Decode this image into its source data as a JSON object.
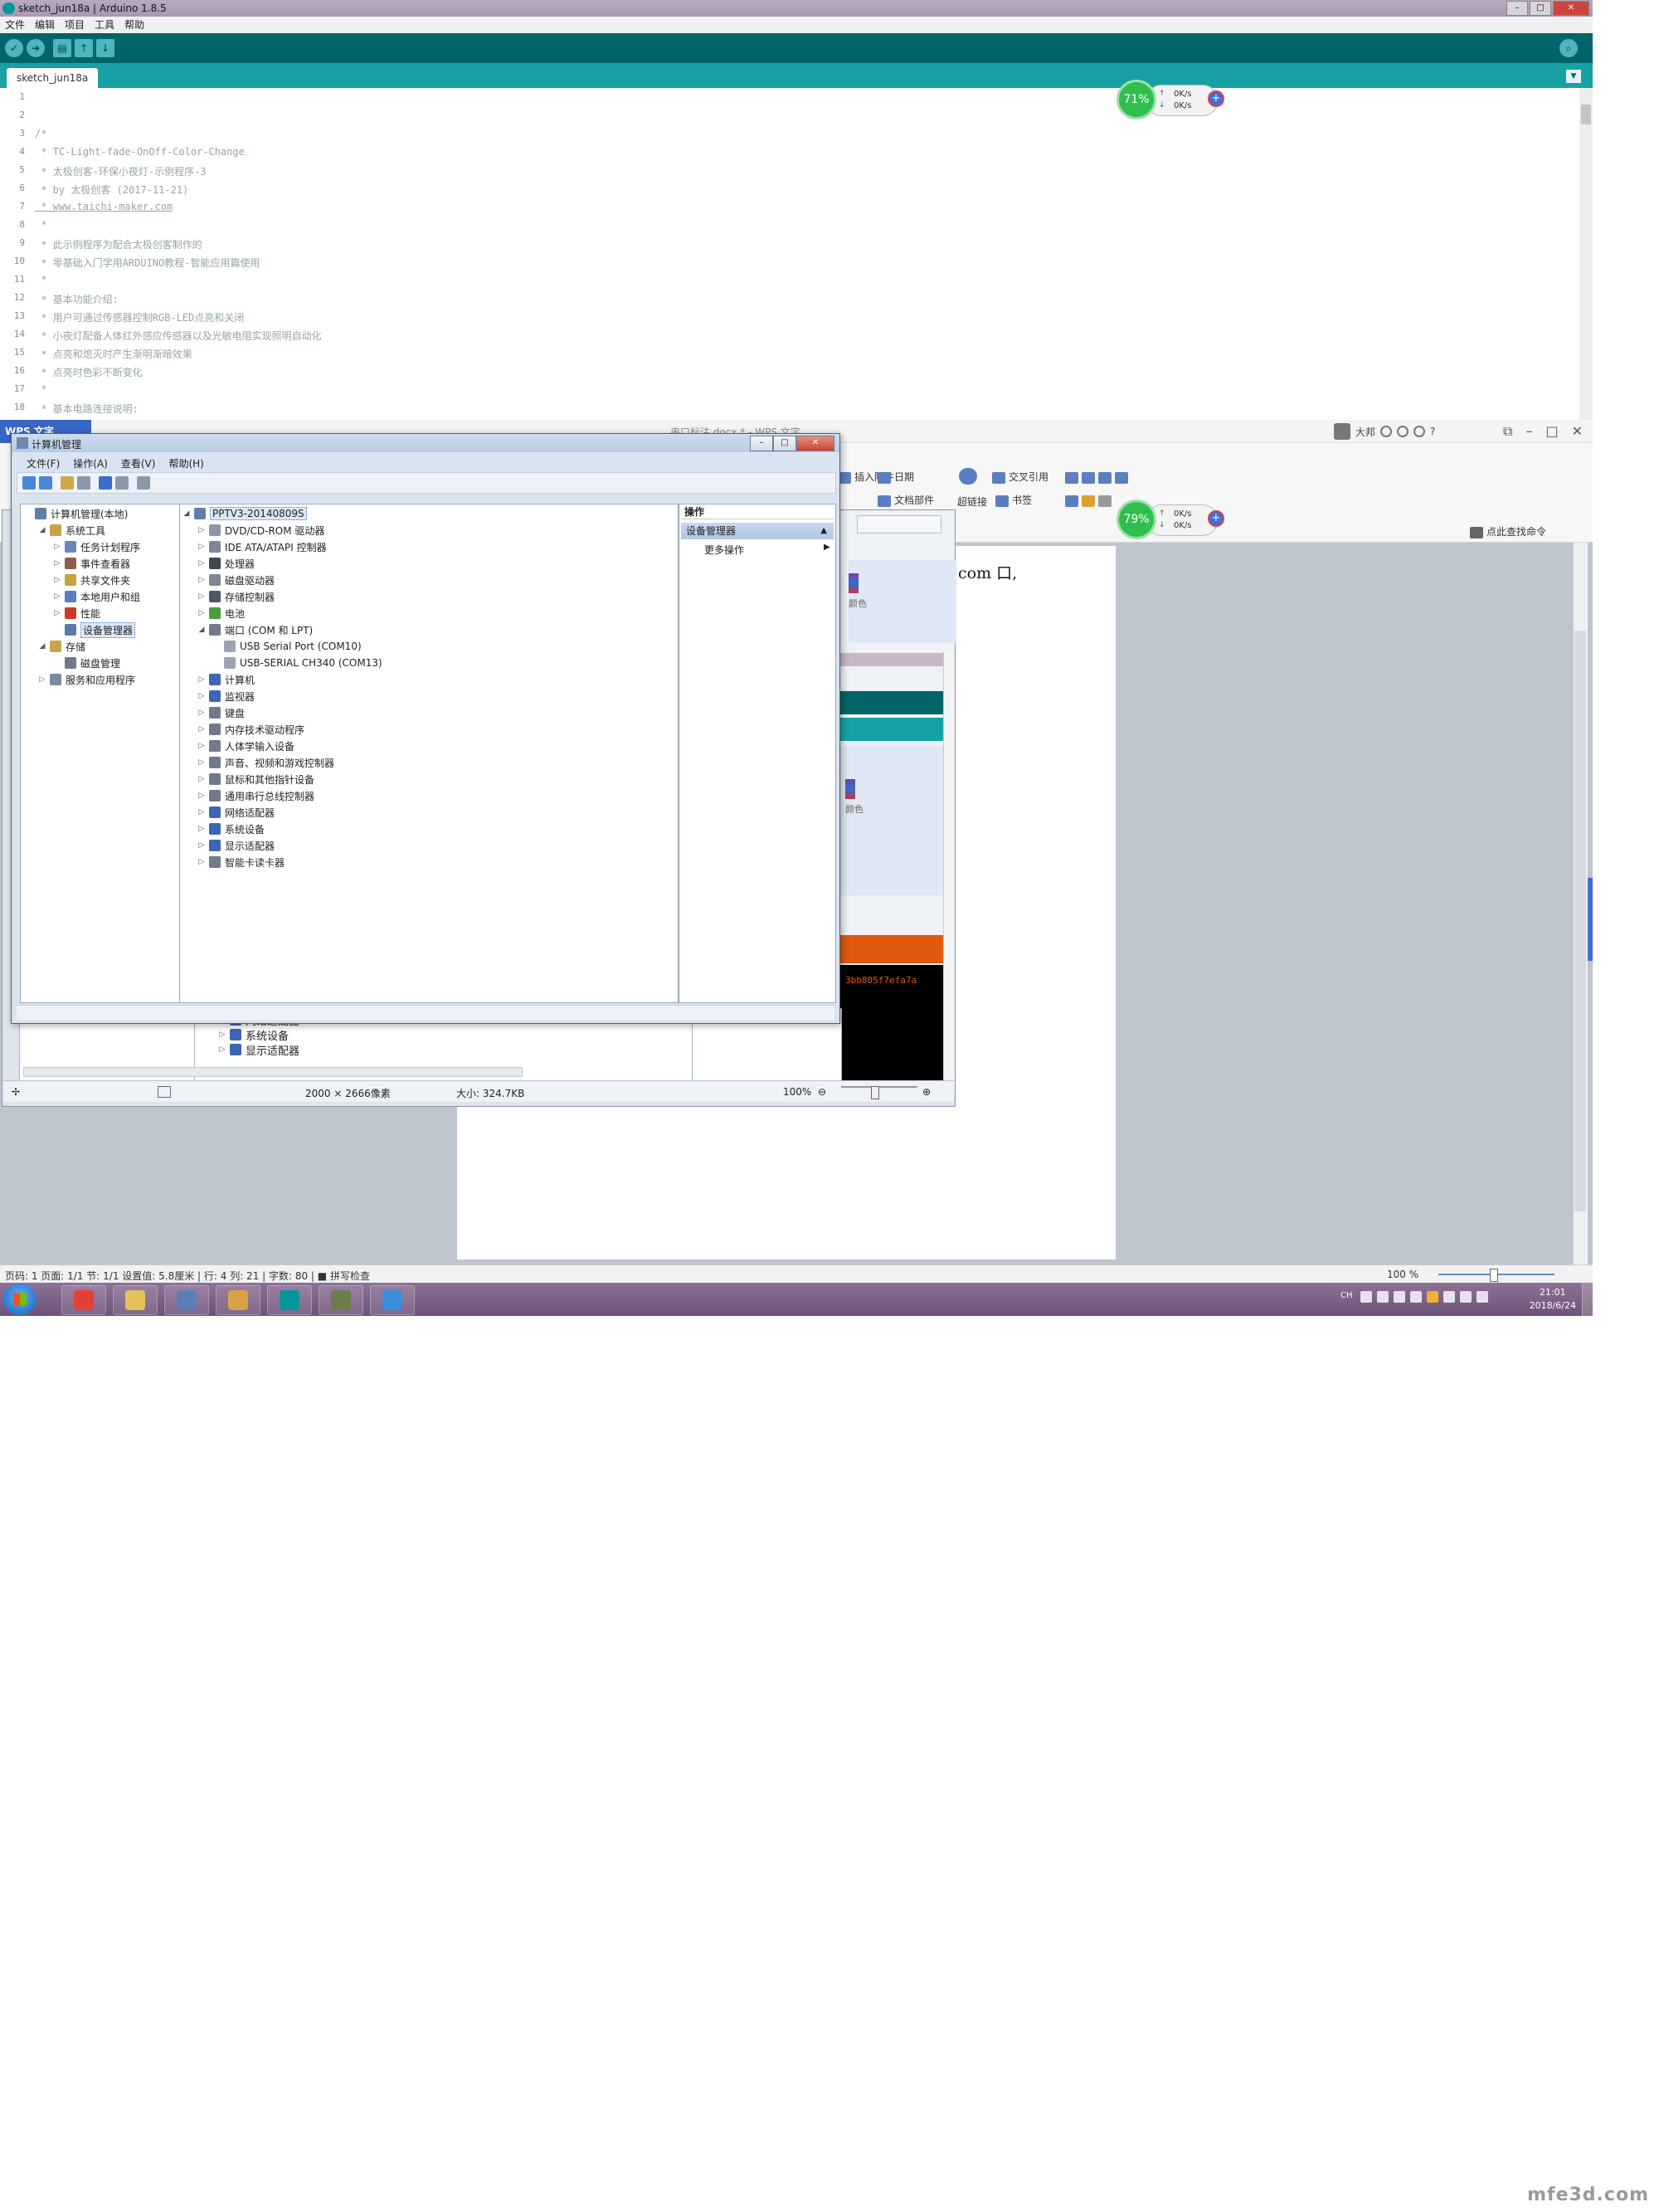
{
  "arduino": {
    "title": "sketch_jun18a | Arduino 1.8.5",
    "menu": [
      "文件",
      "编辑",
      "项目",
      "工具",
      "帮助"
    ],
    "tab": "sketch_jun18a",
    "lines": [
      {
        "n": "1",
        "text": ""
      },
      {
        "n": "2",
        "text": ""
      },
      {
        "n": "3",
        "text": "/*"
      },
      {
        "n": "4",
        "text": " * TC-Light-fade-OnOff-Color-Change"
      },
      {
        "n": "5",
        "text": " * 太极创客-环保小夜灯-示例程序-3"
      },
      {
        "n": "6",
        "text": " * by 太极创客 (2017-11-21)"
      },
      {
        "n": "7",
        "text": " * www.taichi-maker.com"
      },
      {
        "n": "8",
        "text": " *"
      },
      {
        "n": "9",
        "text": " * 此示例程序为配合太极创客制作的"
      },
      {
        "n": "10",
        "text": " * 零基础入门学用ARDUINO教程-智能应用篇使用"
      },
      {
        "n": "11",
        "text": " *"
      },
      {
        "n": "12",
        "text": " * 基本功能介绍:"
      },
      {
        "n": "13",
        "text": " * 用户可通过传感器控制RGB-LED点亮和关闭"
      },
      {
        "n": "14",
        "text": " * 小夜灯配备人体红外感应传感器以及光敏电阻实现照明自动化"
      },
      {
        "n": "15",
        "text": " * 点亮和熄灭时产生渐明渐暗效果"
      },
      {
        "n": "16",
        "text": " * 点亮时色彩不断变化"
      },
      {
        "n": "17",
        "text": " *"
      },
      {
        "n": "18",
        "text": " * 基本电路连接说明:"
      }
    ]
  },
  "speed_top": {
    "percent": "71%",
    "up": "0K/s",
    "down": "0K/s"
  },
  "speed_mid": {
    "percent": "79%",
    "up": "0K/s",
    "down": "0K/s"
  },
  "wps": {
    "tab": "WPS 文字",
    "doc_title": "串口标注.docx * - WPS 文字",
    "user": "大邦",
    "ribbon": {
      "attach": "插入附件",
      "docpart": "文档部件",
      "date": "日期",
      "xref": "交叉引用",
      "hyperlink": "超链接",
      "bookmark": "书签",
      "search": "点此查找命令"
    },
    "doc_text": "com  口,",
    "status": "页码: 1   页面: 1/1   节: 1/1   设置值: 5.8厘米 | 行: 4  列: 21 | 字数: 80 | ■ 拼写检查",
    "zoom": "100 %"
  },
  "viewer": {
    "dims": "2000 × 2666像素",
    "size": "大小: 324.7KB",
    "zoom": "100%",
    "hex_fragment": "3bb805f7efa7a",
    "color_label_1": "颜色",
    "color_label_2": "颜色",
    "tree_fragment": [
      "网络适配器",
      "系统设备",
      "显示适配器"
    ]
  },
  "cm": {
    "title": "计算机管理",
    "menu": [
      "文件(F)",
      "操作(A)",
      "查看(V)",
      "帮助(H)"
    ],
    "left_tree": [
      {
        "label": "计算机管理(本地)",
        "level": 0,
        "exp": "",
        "color": "#5f7ea8"
      },
      {
        "label": "系统工具",
        "level": 1,
        "exp": "◢",
        "color": "#caa24a"
      },
      {
        "label": "任务计划程序",
        "level": 2,
        "exp": "▷",
        "color": "#6a86b5"
      },
      {
        "label": "事件查看器",
        "level": 2,
        "exp": "▷",
        "color": "#8e5f4a"
      },
      {
        "label": "共享文件夹",
        "level": 2,
        "exp": "▷",
        "color": "#c9a241"
      },
      {
        "label": "本地用户和组",
        "level": 2,
        "exp": "▷",
        "color": "#5b7dc2"
      },
      {
        "label": "性能",
        "level": 2,
        "exp": "▷",
        "color": "#cc3a2a"
      },
      {
        "label": "设备管理器",
        "level": 2,
        "exp": "",
        "color": "#5a7aa8",
        "selected": true
      },
      {
        "label": "存储",
        "level": 1,
        "exp": "◢",
        "color": "#caa24a"
      },
      {
        "label": "磁盘管理",
        "level": 2,
        "exp": "",
        "color": "#6d7a8c"
      },
      {
        "label": "服务和应用程序",
        "level": 1,
        "exp": "▷",
        "color": "#7b8aa0"
      }
    ],
    "device_root": "PPTV3-20140809S",
    "devices": [
      {
        "label": "DVD/CD-ROM 驱动器",
        "level": 1,
        "exp": "▷",
        "color": "#8c96a6"
      },
      {
        "label": "IDE ATA/ATAPI 控制器",
        "level": 1,
        "exp": "▷",
        "color": "#7d8796"
      },
      {
        "label": "处理器",
        "level": 1,
        "exp": "▷",
        "color": "#3f4854"
      },
      {
        "label": "磁盘驱动器",
        "level": 1,
        "exp": "▷",
        "color": "#7d8796"
      },
      {
        "label": "存储控制器",
        "level": 1,
        "exp": "▷",
        "color": "#4c5866"
      },
      {
        "label": "电池",
        "level": 1,
        "exp": "▷",
        "color": "#4a9c3c"
      },
      {
        "label": "端口 (COM 和 LPT)",
        "level": 1,
        "exp": "◢",
        "color": "#6f7b8a"
      },
      {
        "label": "USB Serial Port (COM10)",
        "level": 2,
        "exp": "",
        "color": "#9aa4b2"
      },
      {
        "label": "USB-SERIAL CH340 (COM13)",
        "level": 2,
        "exp": "",
        "color": "#9aa4b2"
      },
      {
        "label": "计算机",
        "level": 1,
        "exp": "▷",
        "color": "#3d66b5"
      },
      {
        "label": "监视器",
        "level": 1,
        "exp": "▷",
        "color": "#3d66b5"
      },
      {
        "label": "键盘",
        "level": 1,
        "exp": "▷",
        "color": "#6f7b8a"
      },
      {
        "label": "内存技术驱动程序",
        "level": 1,
        "exp": "▷",
        "color": "#6f7b8a"
      },
      {
        "label": "人体学输入设备",
        "level": 1,
        "exp": "▷",
        "color": "#6f7b8a"
      },
      {
        "label": "声音、视频和游戏控制器",
        "level": 1,
        "exp": "▷",
        "color": "#6f7b8a"
      },
      {
        "label": "鼠标和其他指针设备",
        "level": 1,
        "exp": "▷",
        "color": "#6f7b8a"
      },
      {
        "label": "通用串行总线控制器",
        "level": 1,
        "exp": "▷",
        "color": "#6f7b8a"
      },
      {
        "label": "网络适配器",
        "level": 1,
        "exp": "▷",
        "color": "#3d66b5"
      },
      {
        "label": "系统设备",
        "level": 1,
        "exp": "▷",
        "color": "#3d66b5"
      },
      {
        "label": "显示适配器",
        "level": 1,
        "exp": "▷",
        "color": "#3d66b5"
      },
      {
        "label": "智能卡读卡器",
        "level": 1,
        "exp": "▷",
        "color": "#6f7b8a"
      }
    ],
    "actions_header": "操作",
    "actions_section": "设备管理器",
    "actions_more": "更多操作"
  },
  "taskbar": {
    "time": "21:01",
    "date": "2018/6/24",
    "lang": "CH",
    "apps": [
      {
        "name": "chrome-icon",
        "color": "#e44034"
      },
      {
        "name": "folder-icon",
        "color": "#e6c15a"
      },
      {
        "name": "computer-management-icon",
        "color": "#5c7fb5"
      },
      {
        "name": "paint-icon",
        "color": "#d9a246"
      },
      {
        "name": "arduino-icon",
        "color": "#00979c"
      },
      {
        "name": "game-icon",
        "color": "#6b7d4a"
      },
      {
        "name": "wps-icon",
        "color": "#3b8de0"
      }
    ]
  },
  "watermark": "mfe3d.com"
}
